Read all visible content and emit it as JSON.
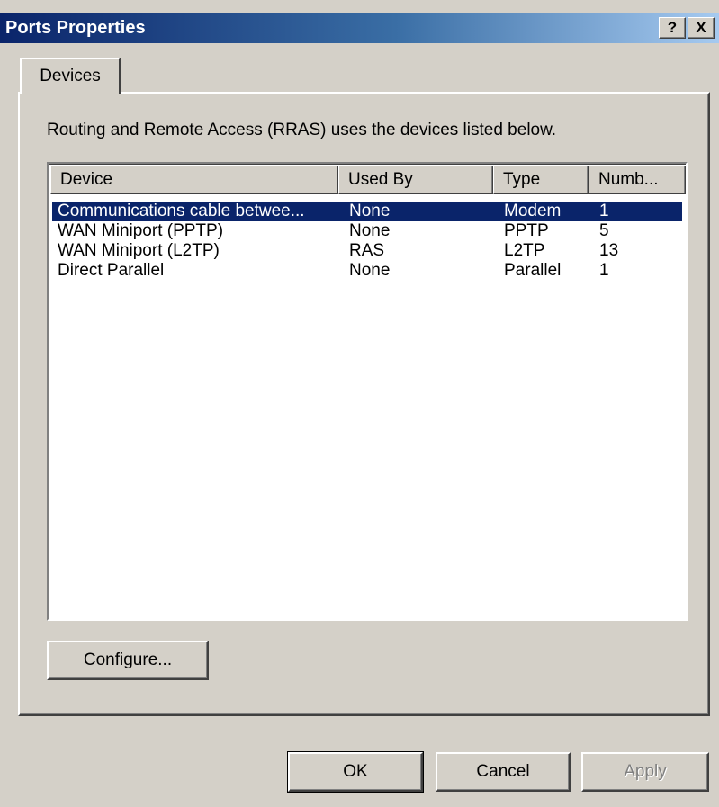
{
  "window": {
    "title": "Ports Properties",
    "help_label": "?",
    "close_label": "X"
  },
  "tabs": [
    {
      "label": "Devices"
    }
  ],
  "description": "Routing and Remote Access (RRAS) uses the devices listed below.",
  "table": {
    "columns": [
      "Device",
      "Used By",
      "Type",
      "Numb..."
    ],
    "rows": [
      {
        "device": "Communications cable betwee...",
        "used_by": "None",
        "type": "Modem",
        "number": "1",
        "selected": true
      },
      {
        "device": "WAN Miniport (PPTP)",
        "used_by": "None",
        "type": "PPTP",
        "number": "5"
      },
      {
        "device": "WAN Miniport (L2TP)",
        "used_by": "RAS",
        "type": "L2TP",
        "number": "13"
      },
      {
        "device": "Direct Parallel",
        "used_by": "None",
        "type": "Parallel",
        "number": "1"
      }
    ]
  },
  "buttons": {
    "configure": "Configure...",
    "ok": "OK",
    "cancel": "Cancel",
    "apply": "Apply"
  },
  "colors": {
    "title_bar": "#0a246a",
    "selection": "#0a246a",
    "dialog_bg": "#d4d0c8"
  }
}
